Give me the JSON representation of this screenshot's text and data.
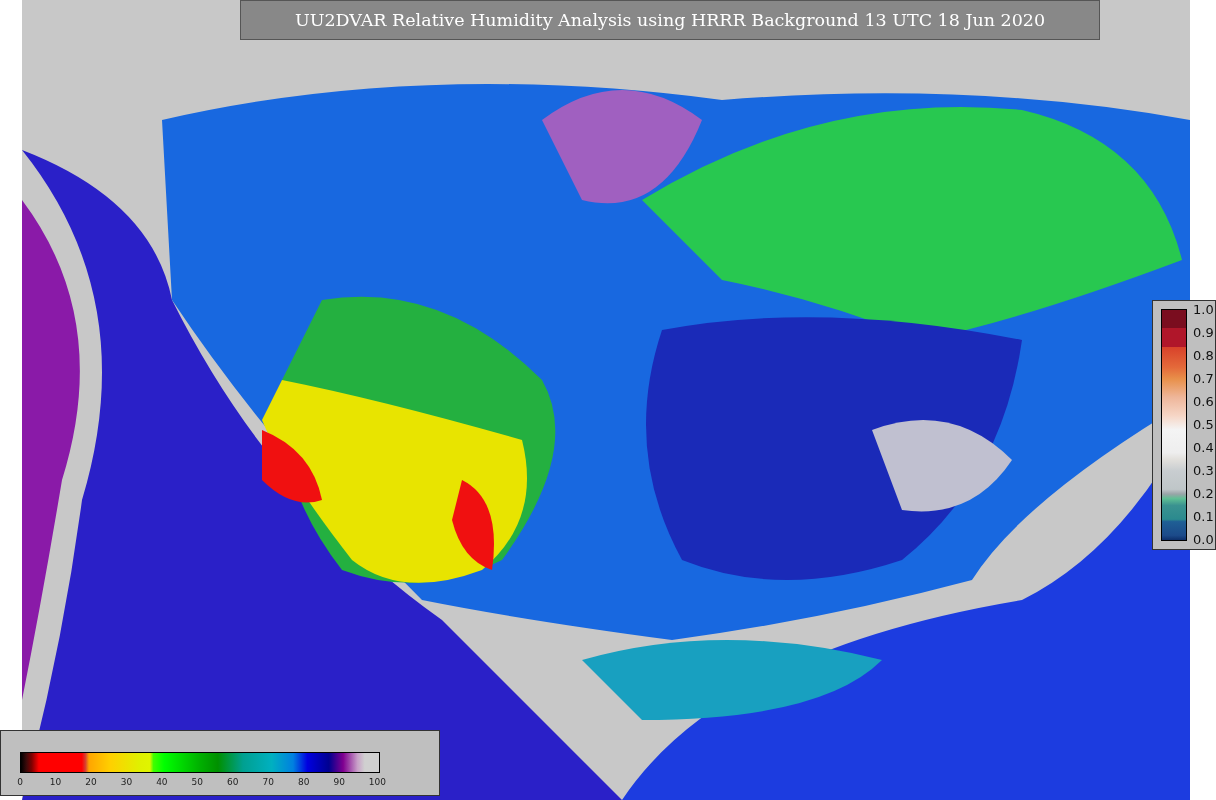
{
  "title": "UU2DVAR Relative Humidity Analysis using HRRR Background 13 UTC 18 Jun 2020",
  "observation_scale": {
    "ticks": [
      "1.0",
      "0.9",
      "0.8",
      "0.7",
      "0.6",
      "0.5",
      "0.4",
      "0.3",
      "0.2",
      "0.1",
      "0.0"
    ]
  },
  "humidity_scale": {
    "ticks": [
      "0",
      "10",
      "20",
      "30",
      "40",
      "50",
      "60",
      "70",
      "80",
      "90",
      "100"
    ]
  }
}
